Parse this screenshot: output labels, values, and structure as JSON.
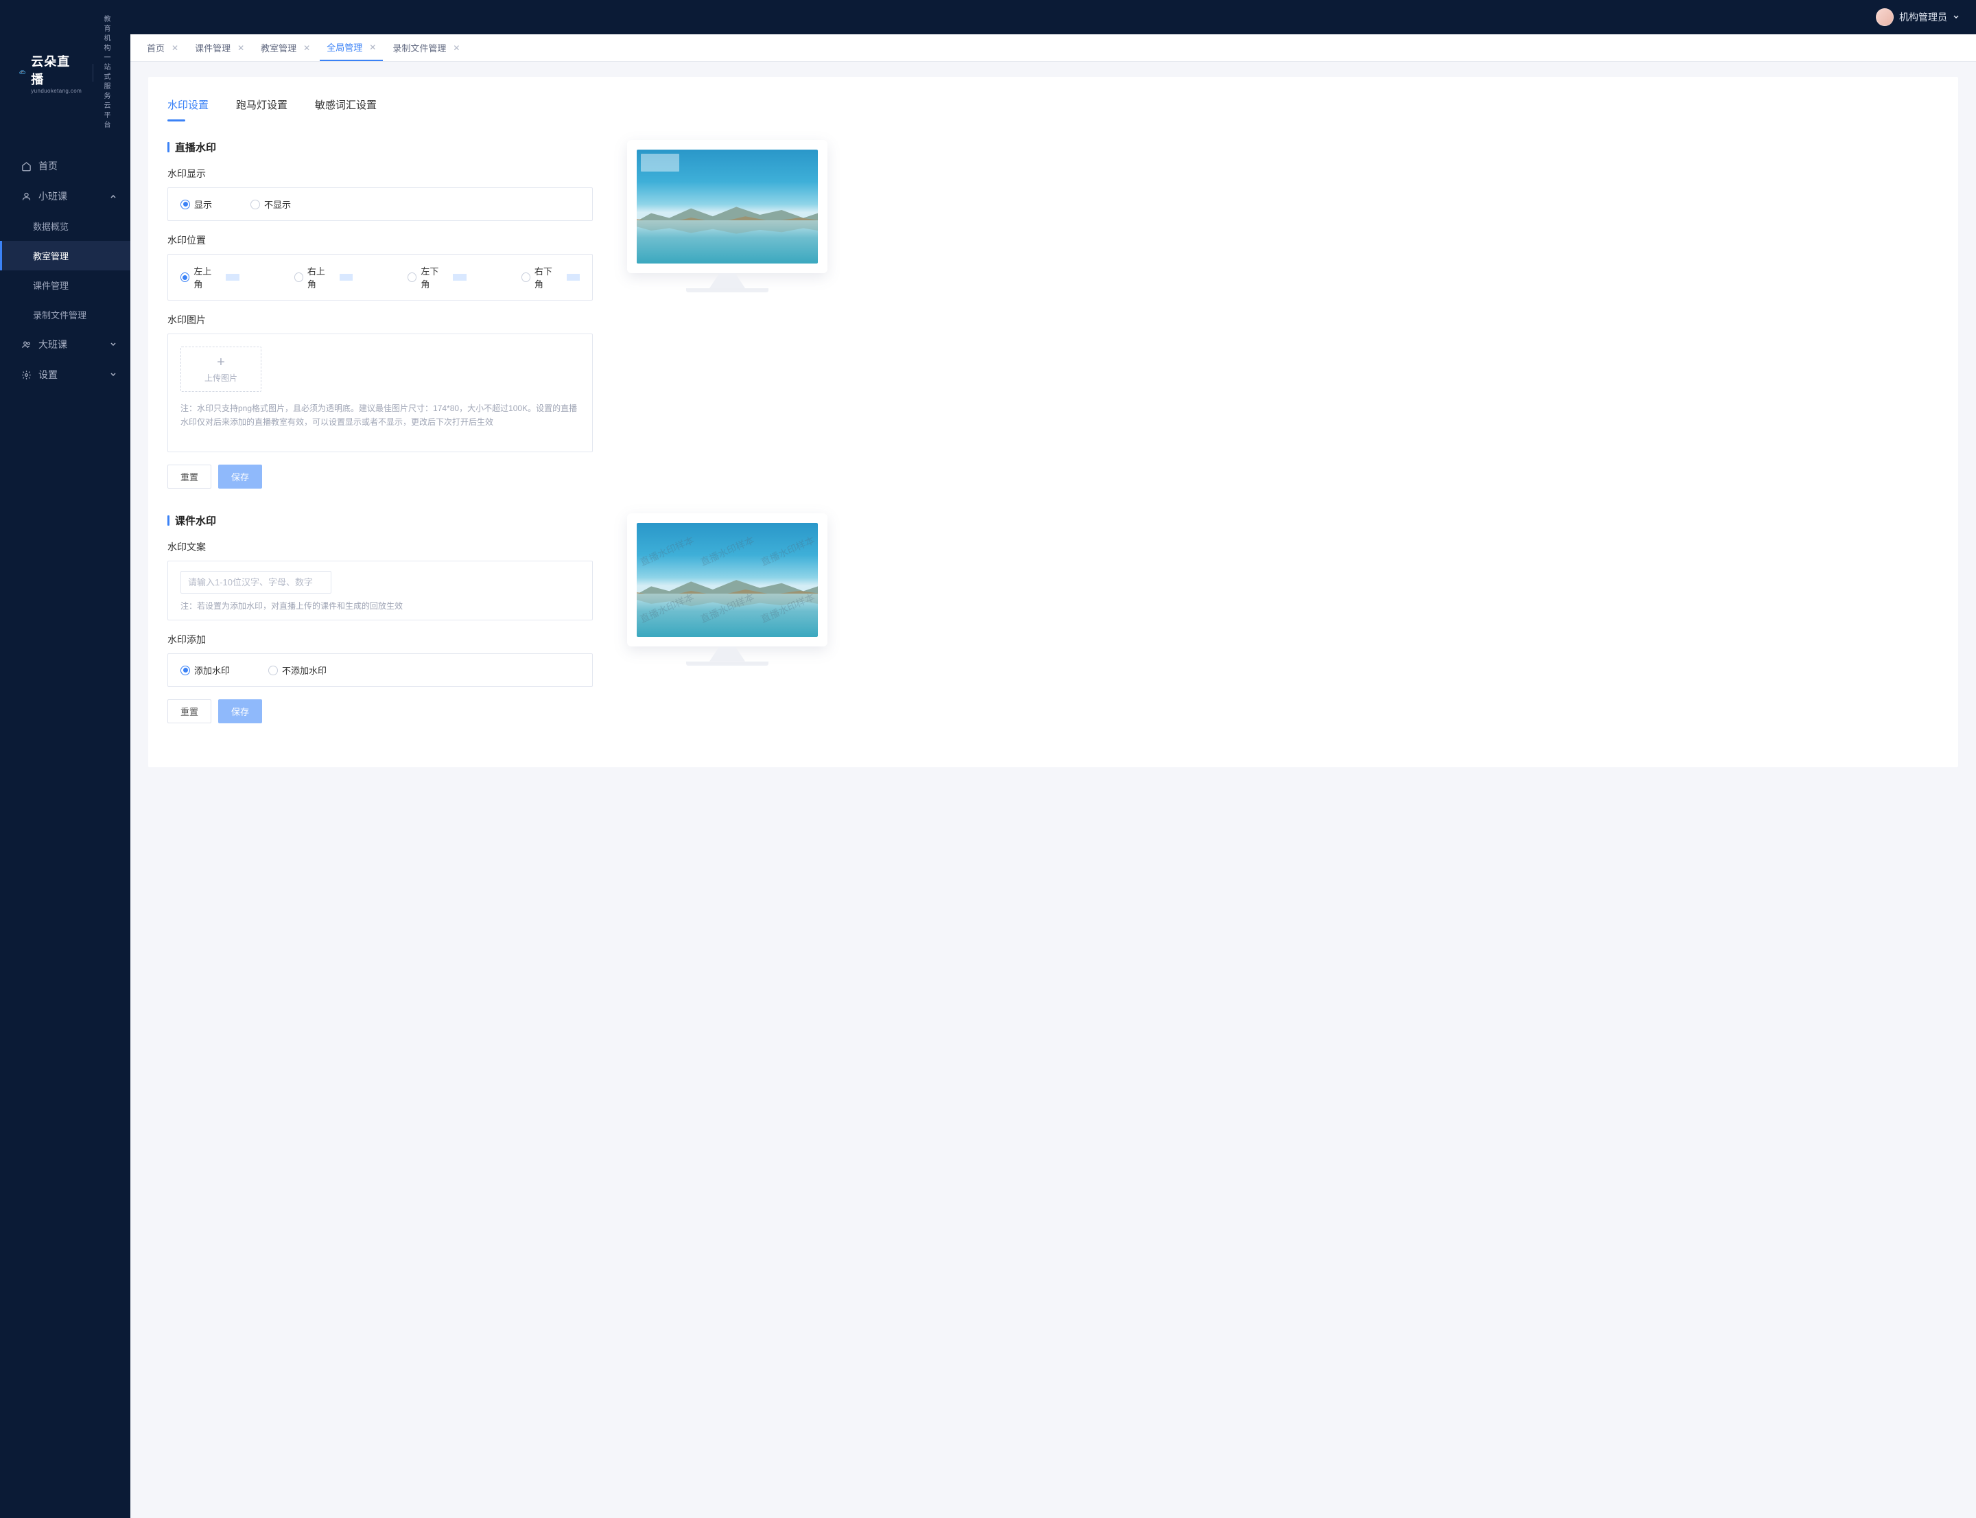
{
  "brand": {
    "name": "云朵直播",
    "domain": "yunduoketang.com",
    "tagline1": "教育机构一站",
    "tagline2": "式服务云平台"
  },
  "user": {
    "role_label": "机构管理员"
  },
  "sidebar": {
    "home": "首页",
    "small_class": "小班课",
    "small_class_items": {
      "data_overview": "数据概览",
      "classroom_mgr": "教室管理",
      "courseware_mgr": "课件管理",
      "recording_mgr": "录制文件管理"
    },
    "big_class": "大班课",
    "settings": "设置"
  },
  "tabs": [
    {
      "label": "首页",
      "active": false
    },
    {
      "label": "课件管理",
      "active": false
    },
    {
      "label": "教室管理",
      "active": false
    },
    {
      "label": "全局管理",
      "active": true
    },
    {
      "label": "录制文件管理",
      "active": false
    }
  ],
  "subtabs": {
    "watermark": "水印设置",
    "marquee": "跑马灯设置",
    "sensitive": "敏感词汇设置"
  },
  "live_wm": {
    "title": "直播水印",
    "display_label": "水印显示",
    "opt_show": "显示",
    "opt_hide": "不显示",
    "position_label": "水印位置",
    "pos_tl": "左上角",
    "pos_tr": "右上角",
    "pos_bl": "左下角",
    "pos_br": "右下角",
    "image_label": "水印图片",
    "upload_text": "上传图片",
    "note": "注：水印只支持png格式图片，且必须为透明底。建议最佳图片尺寸：174*80，大小不超过100K。设置的直播水印仅对后来添加的直播教室有效，可以设置显示或者不显示，更改后下次打开后生效"
  },
  "cw_wm": {
    "title": "课件水印",
    "text_label": "水印文案",
    "placeholder": "请输入1-10位汉字、字母、数字",
    "note": "注：若设置为添加水印，对直播上传的课件和生成的回放生效",
    "add_label": "水印添加",
    "opt_add": "添加水印",
    "opt_noadd": "不添加水印"
  },
  "diag_watermark_sample": "直播水印样本",
  "btns": {
    "reset": "重置",
    "save": "保存"
  }
}
